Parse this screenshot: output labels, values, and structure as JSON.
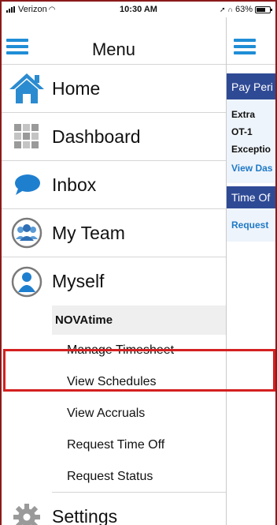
{
  "status": {
    "carrier": "Verizon",
    "time": "10:30 AM",
    "battery": "63%"
  },
  "menu": {
    "title": "Menu",
    "items": [
      {
        "label": "Home",
        "icon": "home-icon"
      },
      {
        "label": "Dashboard",
        "icon": "dashboard-grid-icon"
      },
      {
        "label": "Inbox",
        "icon": "chat-bubble-icon"
      },
      {
        "label": "My Team",
        "icon": "team-icon"
      },
      {
        "label": "Myself",
        "icon": "person-icon"
      }
    ],
    "submenu": {
      "heading": "NOVAtime",
      "items": [
        "Manage Timesheet",
        "View Schedules",
        "View Accruals",
        "Request Time Off",
        "Request Status"
      ]
    },
    "settings": {
      "label": "Settings",
      "icon": "gear-icon"
    }
  },
  "peek": {
    "pay_period": "Pay Peri",
    "line1": "Extra",
    "line2": "OT-1",
    "line3": "Exceptio",
    "link1": "View Das",
    "time_off": "Time Of",
    "link2": "Request"
  },
  "colors": {
    "accent_blue": "#1f8ed6",
    "header_navy": "#2f4a95",
    "highlight_red": "#d42020"
  }
}
